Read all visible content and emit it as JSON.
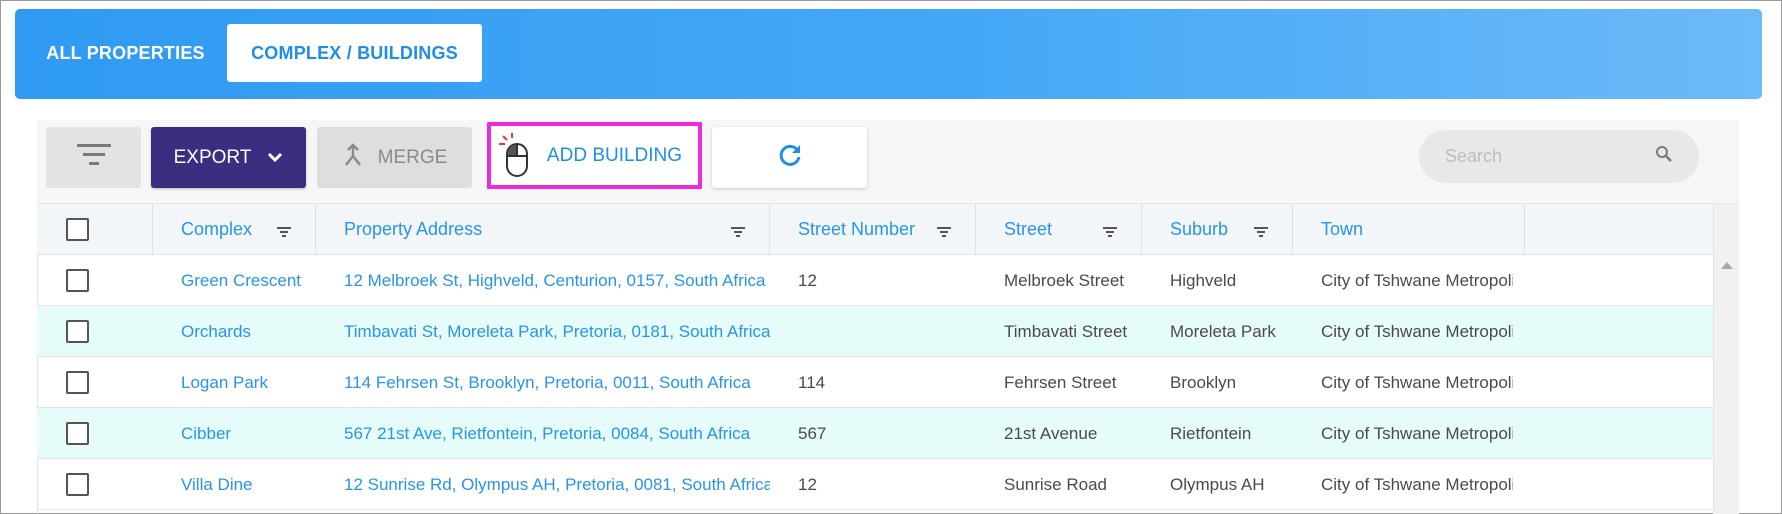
{
  "tabs": [
    {
      "label": "ALL PROPERTIES"
    },
    {
      "label": "COMPLEX / BUILDINGS"
    }
  ],
  "toolbar": {
    "export_label": "EXPORT",
    "merge_label": "MERGE",
    "add_label": "ADD BUILDING",
    "search_placeholder": "Search"
  },
  "icons": {
    "filter": "filter-lines-icon",
    "export_caret": "chevron-down-icon",
    "merge": "merge-arrows-icon",
    "add_cursor": "mouse-click-icon",
    "refresh": "refresh-icon",
    "search": "search-icon",
    "column_filter": "column-filter-icon"
  },
  "colors": {
    "header_gradient_start": "#2f9af2",
    "header_gradient_end": "#6cbaf8",
    "accent": "#1e8fe6",
    "export_bg": "#3b2d80",
    "highlight_border": "#ef29dc",
    "alt_row": "#e6fcfb"
  },
  "table": {
    "columns": [
      {
        "label": "Complex"
      },
      {
        "label": "Property Address"
      },
      {
        "label": "Street Number"
      },
      {
        "label": "Street"
      },
      {
        "label": "Suburb"
      },
      {
        "label": "Town"
      }
    ],
    "rows": [
      {
        "complex": "Green Crescent",
        "address": "12 Melbroek St, Highveld, Centurion, 0157, South Africa",
        "number": "12",
        "street": "Melbroek Street",
        "suburb": "Highveld",
        "town": "City of Tshwane Metropolitan Municipality"
      },
      {
        "complex": "Orchards",
        "address": "Timbavati St, Moreleta Park, Pretoria, 0181, South Africa",
        "number": "",
        "street": "Timbavati Street",
        "suburb": "Moreleta Park",
        "town": "City of Tshwane Metropolitan Municipality"
      },
      {
        "complex": "Logan Park",
        "address": "114 Fehrsen St, Brooklyn, Pretoria, 0011, South Africa",
        "number": "114",
        "street": "Fehrsen Street",
        "suburb": "Brooklyn",
        "town": "City of Tshwane Metropolitan Municipality"
      },
      {
        "complex": "Cibber",
        "address": "567 21st Ave, Rietfontein, Pretoria, 0084, South Africa",
        "number": "567",
        "street": "21st Avenue",
        "suburb": "Rietfontein",
        "town": "City of Tshwane Metropolitan Municipality"
      },
      {
        "complex": "Villa Dine",
        "address": "12 Sunrise Rd, Olympus AH, Pretoria, 0081, South Africa",
        "number": "12",
        "street": "Sunrise Road",
        "suburb": "Olympus AH",
        "town": "City of Tshwane Metropolitan Municipality"
      }
    ]
  }
}
